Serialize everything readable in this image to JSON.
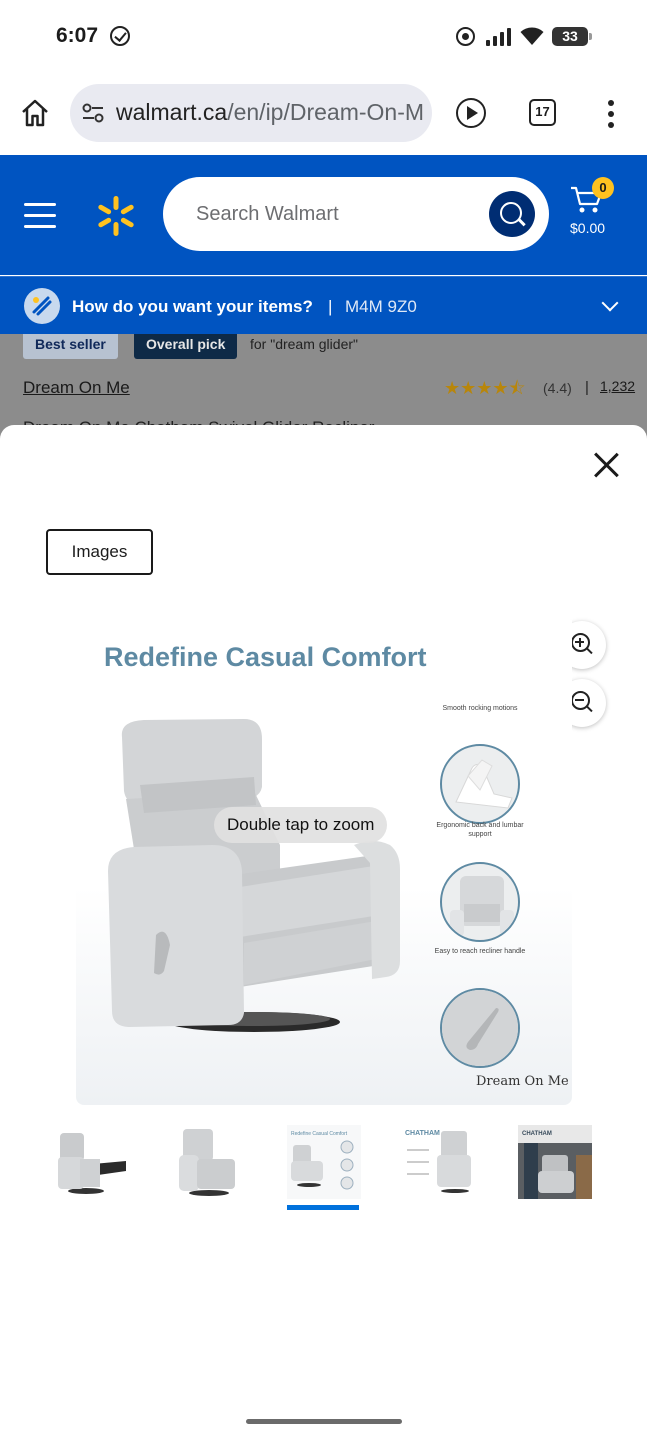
{
  "status_bar": {
    "time": "6:07",
    "battery": "33"
  },
  "browser": {
    "url_host": "walmart.ca",
    "url_path": "/en/ip/Dream-On-M",
    "tab_count": "17"
  },
  "header": {
    "search_placeholder": "Search Walmart",
    "cart_count": "0",
    "cart_total": "$0.00"
  },
  "delivery": {
    "question": "How do you want your items?",
    "separator": "|",
    "postal_code": "M4M 9Z0"
  },
  "product_behind": {
    "badge_best_seller": "Best seller",
    "badge_overall_pick": "Overall pick",
    "pick_context": "for \"dream glider\"",
    "brand": "Dream On Me",
    "stars": "★★★★⯪",
    "rating": "(4.4)",
    "separator": "|",
    "review_count": "1,232",
    "title": "Dream On Me Chatham Swivel Glider Recliner"
  },
  "modal": {
    "tab_images": "Images",
    "double_tap_hint": "Double tap to zoom",
    "hero": {
      "title": "Redefine Casual Comfort",
      "features": [
        {
          "label": "Smooth rocking motions"
        },
        {
          "label": "Ergonomic back and lumbar support"
        },
        {
          "label": "Easy to reach recliner handle"
        }
      ],
      "logo": "Dream On Me"
    },
    "thumbnails": [
      {
        "name": "chair-reclined"
      },
      {
        "name": "chair-front"
      },
      {
        "name": "redefine-casual-comfort",
        "label": "Redefine Casual Comfort",
        "selected": true
      },
      {
        "name": "chatham-dimensions",
        "label": "CHATHAM"
      },
      {
        "name": "chatham-room",
        "label": "CHATHAM"
      }
    ],
    "selected_thumbnail_index": 2
  },
  "colors": {
    "walmart_blue": "#0054c1",
    "walmart_yellow": "#ffc220",
    "accent_blue": "#0071dc",
    "hero_title": "#5e8aa3"
  }
}
